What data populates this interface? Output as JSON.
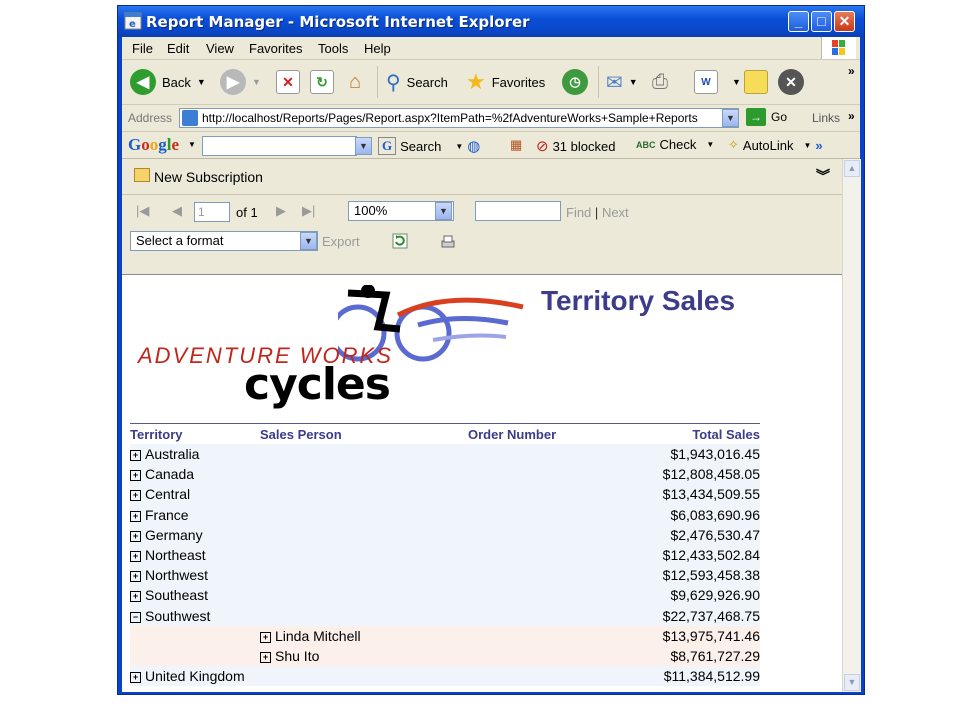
{
  "window": {
    "title": "Report Manager - Microsoft Internet Explorer"
  },
  "menu": {
    "file": "File",
    "edit": "Edit",
    "view": "View",
    "favorites": "Favorites",
    "tools": "Tools",
    "help": "Help"
  },
  "toolbar": {
    "back": "Back",
    "search": "Search",
    "favorites": "Favorites"
  },
  "address": {
    "label": "Address",
    "url": "http://localhost/Reports/Pages/Report.aspx?ItemPath=%2fAdventureWorks+Sample+Reports",
    "go": "Go",
    "links": "Links"
  },
  "google": {
    "logo": "Google",
    "search": "Search",
    "blocked": "31 blocked",
    "check": "Check",
    "autolink": "AutoLink"
  },
  "report_toolbar": {
    "new_subscription": "New Subscription",
    "page_value": "1",
    "of_pages": "of 1",
    "zoom": "100%",
    "find": "Find",
    "find_sep": "|",
    "next": "Next",
    "format": "Select a format",
    "export": "Export"
  },
  "report": {
    "logo_line1": "ADVENTURE WORKS",
    "logo_line2": "cycles",
    "title": "Territory Sales",
    "columns": {
      "territory": "Territory",
      "sales_person": "Sales Person",
      "order_number": "Order Number",
      "total_sales": "Total Sales"
    },
    "rows": [
      {
        "name": "Australia",
        "amount": "$1,943,016.45"
      },
      {
        "name": "Canada",
        "amount": "$12,808,458.05"
      },
      {
        "name": "Central",
        "amount": "$13,434,509.55"
      },
      {
        "name": "France",
        "amount": "$6,083,690.96"
      },
      {
        "name": "Germany",
        "amount": "$2,476,530.47"
      },
      {
        "name": "Northeast",
        "amount": "$12,433,502.84"
      },
      {
        "name": "Northwest",
        "amount": "$12,593,458.38"
      },
      {
        "name": "Southeast",
        "amount": "$9,629,926.90"
      },
      {
        "name": "Southwest",
        "amount": "$22,737,468.75"
      },
      {
        "name": "Linda Mitchell",
        "amount": "$13,975,741.46"
      },
      {
        "name": "Shu Ito",
        "amount": "$8,761,727.29"
      },
      {
        "name": "United Kingdom",
        "amount": "$11,384,512.99"
      }
    ]
  },
  "colors": {
    "titlebar": "#0b4fd8",
    "report_title": "#3c3c8a",
    "territory_row": "#eff5fa",
    "salesperson_row": "#fbf0ea"
  }
}
